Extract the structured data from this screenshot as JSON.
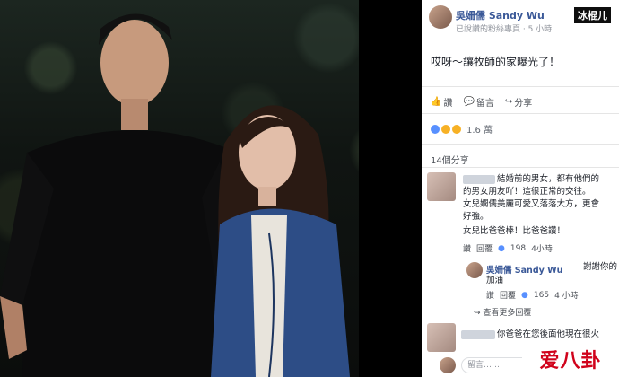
{
  "post": {
    "author": "吳姍儒 Sandy Wu",
    "verified_text": "已說讚的粉絲專頁 · 5 小時",
    "watermark_top": "冰棍儿",
    "text": "哎呀～讓牧師的家曝光了！"
  },
  "actions": {
    "like": "讚",
    "comment": "留言",
    "share": "分享"
  },
  "reactions": {
    "count": "1.6 萬"
  },
  "shares": "14個分享",
  "comments": [
    {
      "lines": [
        "結婚前的男女，都有他們的",
        "的男女朋友吖！這很正常的交往。",
        "女兒嫻儒美麗可愛又落落大方，更會",
        "好強。",
        "女兒比爸爸棒！比爸爸讚！"
      ],
      "meta": [
        "讚",
        "回覆",
        "198",
        "4小時"
      ]
    }
  ],
  "reply": {
    "author": "吳姍儒 Sandy Wu",
    "text_1": "謝謝你的",
    "text_2": "加油",
    "meta": [
      "讚",
      "回覆",
      "165",
      "4 小時"
    ]
  },
  "more_replies": "查看更多回覆",
  "last_comment": "你爸爸在您後面他現在很火",
  "input_placeholder": "留言……",
  "watermark_bottom": "爱八卦",
  "colors": {
    "facebook_blue": "#3b5998",
    "like_blue": "#5890ff",
    "watermark_red": "#d0021b"
  },
  "icons": [
    "like-icon",
    "comment-icon",
    "share-icon",
    "haha-icon",
    "like-reaction-icon",
    "sad-icon",
    "like-count-icon"
  ]
}
